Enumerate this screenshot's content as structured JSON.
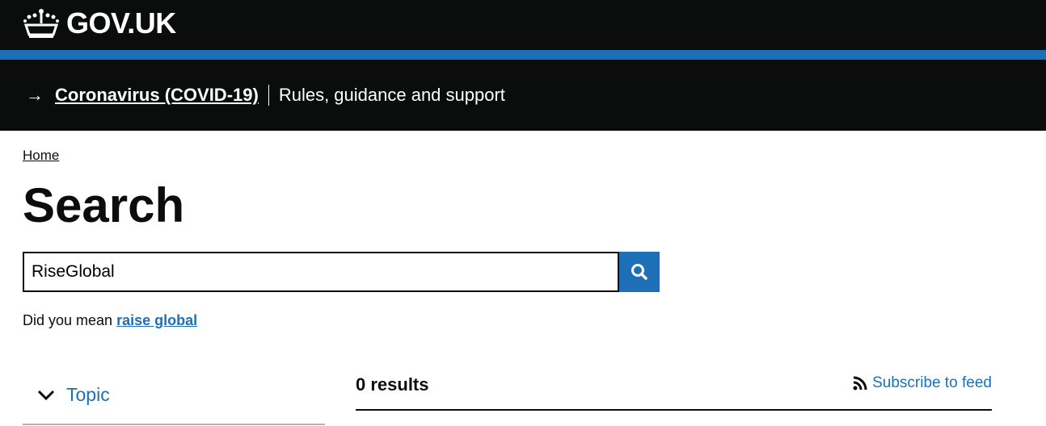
{
  "header": {
    "logo_text": "GOV.UK",
    "logo_icon": "crown-icon"
  },
  "banner": {
    "link": "Coronavirus (COVID-19)",
    "text": "Rules, guidance and support"
  },
  "breadcrumb": {
    "home": "Home"
  },
  "page": {
    "title": "Search"
  },
  "search": {
    "value": "RiseGlobal",
    "button_icon": "search-icon"
  },
  "suggestion": {
    "prefix": "Did you mean",
    "link": "raise global"
  },
  "filters": {
    "topic": "Topic"
  },
  "results": {
    "count_label": "0 results",
    "subscribe": "Subscribe to feed"
  },
  "colors": {
    "brand_blue": "#1d70b8",
    "header_black": "#0b0c0c"
  }
}
